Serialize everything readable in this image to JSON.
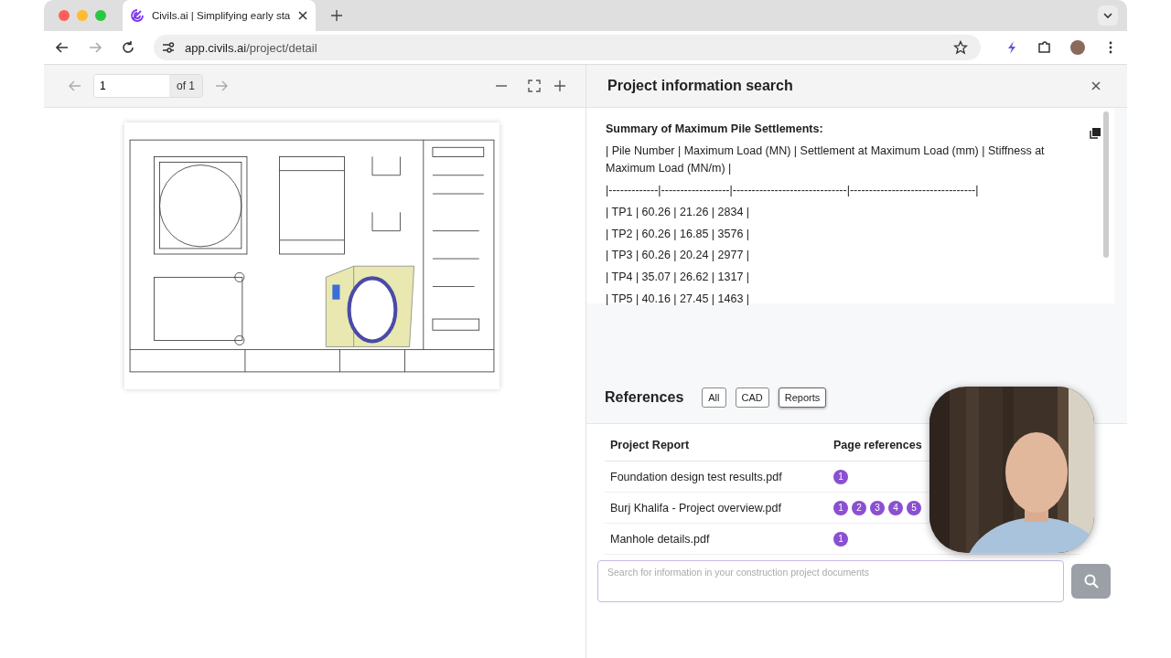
{
  "browser": {
    "tab_title": "Civils.ai | Simplifying early sta",
    "url_host": "app.civils.ai",
    "url_path": "/project/detail"
  },
  "viewer": {
    "page": "1",
    "page_total": "of 1"
  },
  "panel": {
    "title": "Project information search",
    "answer": [
      "**Summary of Maximum Pile Settlements:**",
      "| Pile Number | Maximum Load (MN) | Settlement at Maximum Load (mm) | Stiffness at Maximum Load (MN/m) |",
      "|-------------|------------------|------------------------------|---------------------------------|",
      "| TP1 | 60.26 | 21.26 | 2834 |",
      "| TP2 | 60.26 | 16.85 | 3576 |",
      "| TP3 | 60.26 | 20.24 | 2977 |",
      "| TP4 | 35.07 | 26.62 | 1317 |",
      "| TP5 | 40.16 | 27.45 | 1463 |"
    ]
  },
  "references": {
    "title": "References",
    "filters": [
      {
        "label": "All",
        "selected": false
      },
      {
        "label": "CAD",
        "selected": false
      },
      {
        "label": "Reports",
        "selected": true
      }
    ],
    "columns": [
      "Project Report",
      "Page references"
    ],
    "rows": [
      {
        "name": "Foundation design test results.pdf",
        "pages": [
          "1"
        ]
      },
      {
        "name": "Burj Khalifa - Project overview.pdf",
        "pages": [
          "1",
          "2",
          "3",
          "4",
          "5"
        ]
      },
      {
        "name": "Manhole details.pdf",
        "pages": [
          "1"
        ]
      }
    ]
  },
  "search": {
    "placeholder": "Search for information in your construction project documents"
  }
}
